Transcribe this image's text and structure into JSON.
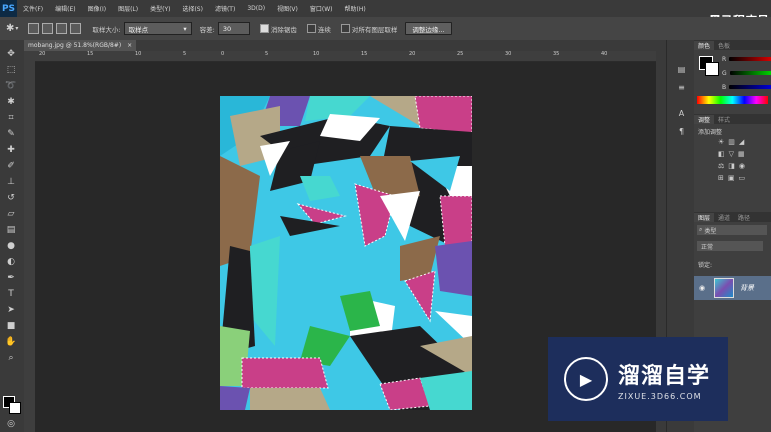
{
  "app": {
    "logo": "PS",
    "menu": [
      "文件(F)",
      "编辑(E)",
      "图像(I)",
      "图层(L)",
      "类型(Y)",
      "选择(S)",
      "滤镜(T)",
      "3D(D)",
      "视图(V)",
      "窗口(W)",
      "帮助(H)"
    ],
    "brand": "黑马程序员"
  },
  "options": {
    "sample_size_label": "取样大小:",
    "sample_size_value": "取样点",
    "tolerance_label": "容差:",
    "tolerance_value": "30",
    "antialias_label": "消除锯齿",
    "contiguous_label": "连续",
    "sample_all_label": "对所有图层取样",
    "refine_edge_button": "调整边缘..."
  },
  "document": {
    "tab_title": "mobang.jpg @ 51.8%(RGB/8#)"
  },
  "rulers": {
    "h_labels": [
      "20",
      "15",
      "10",
      "5",
      "0",
      "5",
      "10",
      "15",
      "20",
      "25",
      "30",
      "35",
      "40"
    ]
  },
  "panels": {
    "color_tab": "颜色",
    "swatches_tab": "色板",
    "r_label": "R",
    "g_label": "G",
    "b_label": "B",
    "adjust_tab": "调整",
    "styles_tab": "样式",
    "add_adjustment": "添加调整",
    "layers_tab": "图层",
    "channels_tab": "通道",
    "paths_tab": "路径",
    "kind_filter": "类型",
    "blend_mode": "正常",
    "lock_label": "锁定:",
    "layer_name": "背景"
  },
  "watermark": {
    "title": "溜溜自学",
    "url": "ZIXUE.3D66.COM"
  },
  "colors": {
    "accent": "#2b8de0",
    "brand": "#1d2e5c"
  }
}
